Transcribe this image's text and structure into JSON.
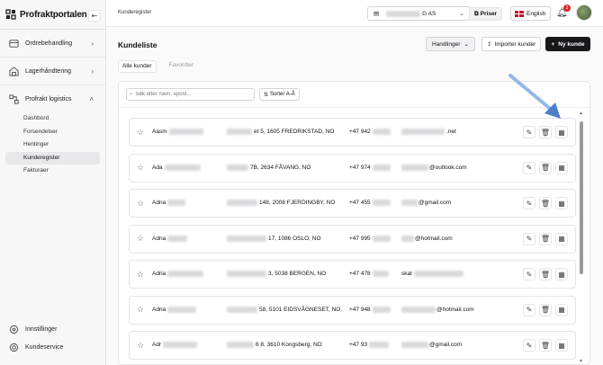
{
  "brand": {
    "name": "Profraktportalen"
  },
  "sidebar": {
    "sections": [
      {
        "label": "Ordrebehandling",
        "icon": "order-icon"
      },
      {
        "label": "Lagerhåndtering",
        "icon": "warehouse-icon"
      },
      {
        "label": "Profrakt logistics",
        "icon": "logistics-icon",
        "items": [
          "Dashbord",
          "Forsendelser",
          "Hentinger",
          "Kunderegister",
          "Fakturaer"
        ],
        "active": "Kunderegister"
      }
    ],
    "bottom": [
      {
        "label": "Innstillinger",
        "icon": "gear-icon"
      },
      {
        "label": "Kundeservice",
        "icon": "support-icon"
      }
    ]
  },
  "topbar": {
    "breadcrumb": "Kunderegister",
    "company": "G AS",
    "prices_label": "Priser",
    "language": "English",
    "notifications": "3"
  },
  "page": {
    "title": "Kundeliste",
    "actions": {
      "handlinger": "Handlinger",
      "import": "Importer kunder",
      "new": "Ny kunde"
    },
    "tabs": [
      "Alle kunder",
      "Favoritter"
    ],
    "search_placeholder": "Søk etter navn, epost...",
    "sort_label": "Sorter A-Å"
  },
  "customers": [
    {
      "name": "Aasm",
      "addr": "et 5, 1605 FREDRIKSTAD, NO",
      "phone": "+47 942",
      "email": ".net"
    },
    {
      "name": "Ada",
      "addr": "7B, 2634 FÅVANG, NO",
      "phone": "+47 974",
      "email": "@outlook.com"
    },
    {
      "name": "Adna",
      "addr": "148, 2008 FJERDINGBY, NO",
      "phone": "+47 455",
      "email": "@gmail.com"
    },
    {
      "name": "Adna",
      "addr": "17, 1086 OSLO, NO",
      "phone": "+47 995",
      "email": "@hotmail.com"
    },
    {
      "name": "Adria",
      "addr": "3, 5038 BERGEN, NO",
      "phone": "+47 478",
      "email": "skat"
    },
    {
      "name": "Adria",
      "addr": "58, 5101 EIDSVÅGNESET, NO.",
      "phone": "+47 948",
      "email": "@hotmail.com"
    },
    {
      "name": "Adr",
      "addr": "6 8, 3610 Kongsberg, NO",
      "phone": "+47 93",
      "email": "@gmail.com"
    }
  ]
}
